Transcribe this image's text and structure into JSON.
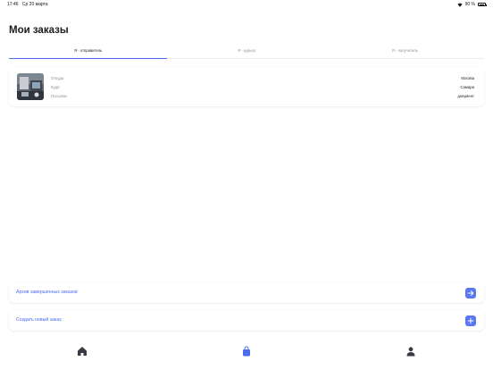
{
  "status_bar": {
    "time": "17:46",
    "date": "Ср 20 марта",
    "battery_percent_label": "90 %",
    "battery_level": 0.9,
    "icons": [
      "wifi-icon",
      "battery-icon"
    ]
  },
  "page": {
    "title": "Мои заказы"
  },
  "tabs": [
    {
      "label": "Я - отправитель",
      "active": true
    },
    {
      "label": "Я - курьер",
      "active": false
    },
    {
      "label": "Я - получатель",
      "active": false
    }
  ],
  "order": {
    "icon": "photo-thumbnail",
    "rows": [
      {
        "label": "Откуда",
        "value": "Москва"
      },
      {
        "label": "Куда",
        "value": "Самара"
      },
      {
        "label": "Посылки",
        "value": "документ"
      }
    ]
  },
  "actions": {
    "archive": {
      "label": "Архив завершенных заказов",
      "icon": "arrow-right-icon"
    },
    "create": {
      "label": "Создать новый заказ",
      "icon": "plus-icon"
    }
  },
  "tabbar": {
    "items": [
      {
        "icon": "home-icon",
        "active": false
      },
      {
        "icon": "shopping-bag-icon",
        "active": true
      },
      {
        "icon": "user-icon",
        "active": false
      }
    ]
  },
  "colors": {
    "accent": "#4a6cf0",
    "inactive_icon": "#3a3a44",
    "muted_text": "#8c8f99"
  }
}
